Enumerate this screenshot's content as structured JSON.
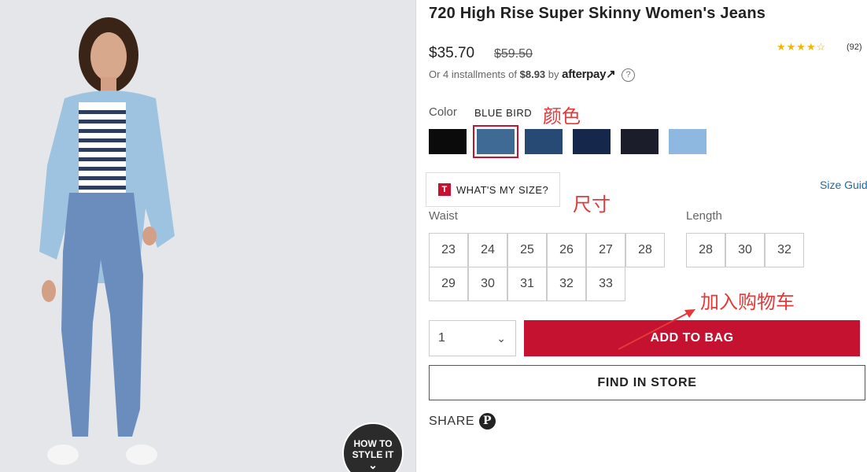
{
  "product": {
    "title": "720 High Rise Super Skinny Women's Jeans",
    "price": "$35.70",
    "old_price": "$59.50",
    "rating_stars": "★★★★☆",
    "reviews": "(92)",
    "rating_color": "#f4b400"
  },
  "installments": {
    "prefix": "Or 4 installments of",
    "amount": "$8.93",
    "by": "by",
    "provider": "afterpay",
    "provider_mark": "↗",
    "help": "?"
  },
  "colors": {
    "label": "Color",
    "selected": "BLUE BIRD",
    "swatches": [
      "#0b0b0b",
      "#3f6a93",
      "#264a74",
      "#15274a",
      "#1b1d2a",
      "#8fb8e0"
    ],
    "selected_index": 1
  },
  "annotations": {
    "color": "颜色",
    "size": "尺寸",
    "add_to_cart": "加入购物车",
    "color_hex": "#e23a3a"
  },
  "sizing": {
    "whats_my_size_badge": "T",
    "whats_my_size": "WHAT'S MY SIZE?",
    "size_guide": "Size Guid",
    "waist_label": "Waist",
    "waist": [
      "23",
      "24",
      "25",
      "26",
      "27",
      "28",
      "29",
      "30",
      "31",
      "32",
      "33"
    ],
    "length_label": "Length",
    "length": [
      "28",
      "30",
      "32"
    ]
  },
  "quantity": {
    "value": "1",
    "chevron": "⌄"
  },
  "buttons": {
    "add_to_bag": "ADD TO BAG",
    "find_in_store": "FIND IN STORE",
    "brand_color": "#c41230"
  },
  "share": {
    "label": "SHARE",
    "pinterest": "P"
  },
  "style_it": {
    "line1": "HOW TO",
    "line2": "STYLE IT",
    "chevron": "⌄"
  }
}
